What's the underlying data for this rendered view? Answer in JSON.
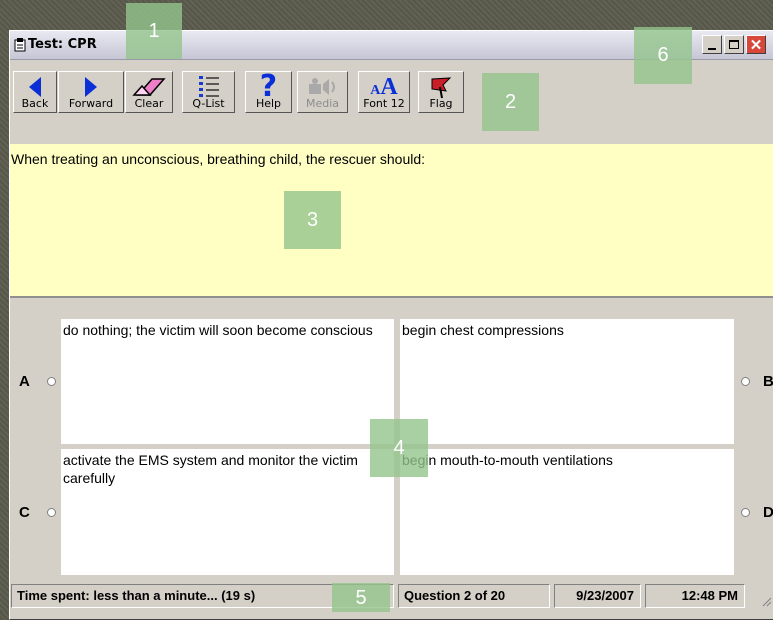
{
  "window": {
    "title": "Test: CPR",
    "controls": [
      "minimize",
      "maximize",
      "close"
    ]
  },
  "toolbar": {
    "buttons": [
      {
        "label": "Back",
        "icon": "back-arrow-icon",
        "enabled": true
      },
      {
        "label": "Forward",
        "icon": "forward-arrow-icon",
        "enabled": true
      },
      {
        "label": "Clear",
        "icon": "eraser-icon",
        "enabled": true
      },
      {
        "label": "Q-List",
        "icon": "list-icon",
        "enabled": true
      },
      {
        "label": "Help",
        "icon": "help-question-icon",
        "enabled": true
      },
      {
        "label": "Media",
        "icon": "media-speaker-icon",
        "enabled": false
      },
      {
        "label": "Font 12",
        "icon": "font-size-icon",
        "enabled": true
      },
      {
        "label": "Flag",
        "icon": "flag-icon",
        "enabled": true
      }
    ]
  },
  "question": {
    "text": "When treating an unconscious, breathing child, the rescuer should:"
  },
  "answers": [
    {
      "letter": "A",
      "text": "do nothing; the victim will soon become conscious",
      "selected": false
    },
    {
      "letter": "B",
      "text": "begin chest compressions",
      "selected": false
    },
    {
      "letter": "C",
      "text": "activate the EMS system and monitor the victim carefully",
      "selected": false
    },
    {
      "letter": "D",
      "text": "begin mouth-to-mouth ventilations",
      "selected": false
    }
  ],
  "status": {
    "time_spent": "Time spent: less than a minute... (19 s)",
    "question_progress": "Question 2 of 20",
    "date": "9/23/2007",
    "time": "12:48 PM"
  },
  "callouts": [
    "1",
    "2",
    "3",
    "4",
    "5",
    "6"
  ],
  "colors": {
    "question_bg": "#ffffc4",
    "arrow_blue": "#0a2fd6",
    "flag_red": "#c81f28",
    "close_red": "#d9463a",
    "callout_green": "#94c48c"
  }
}
